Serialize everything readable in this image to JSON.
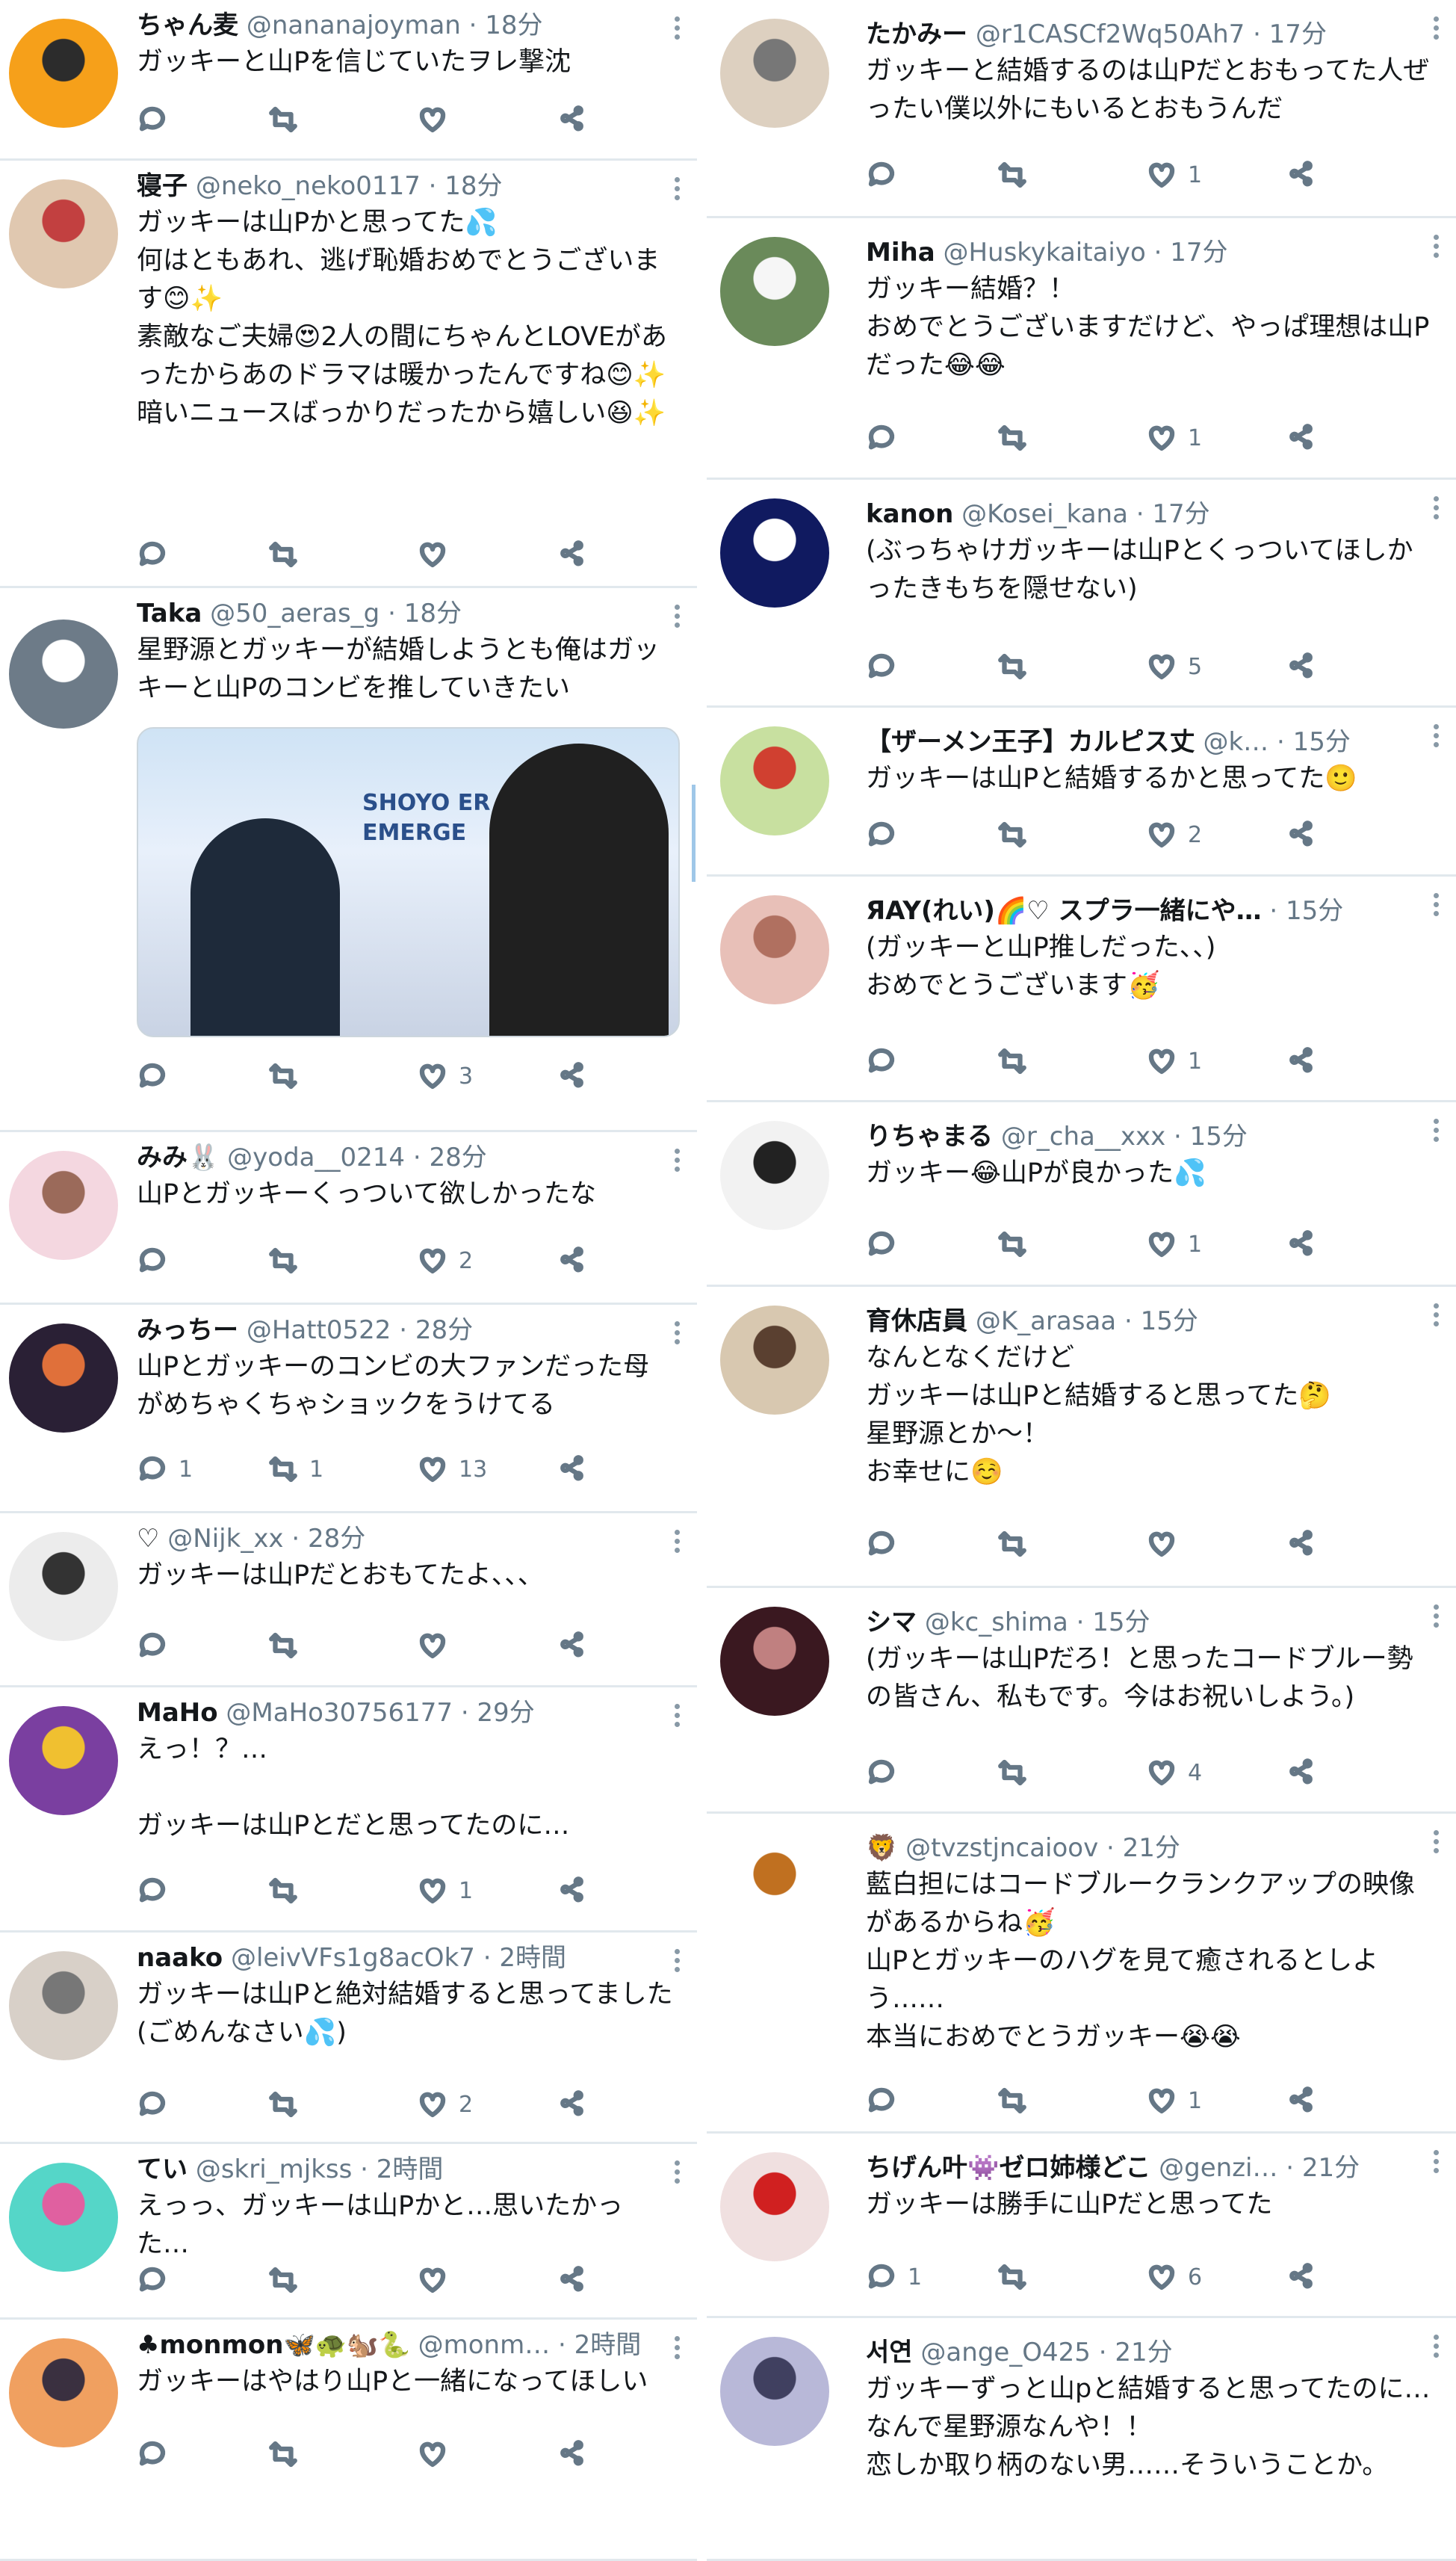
{
  "left": [
    {
      "name": "ちゃん麦",
      "handle": "@nananajoyman",
      "time": "· 18分",
      "text": "ガッキーと山Pを信じていたヲレ撃沈",
      "reply": "",
      "retweet": "",
      "like": ""
    },
    {
      "name": "寝子",
      "handle": "@neko_neko0117",
      "time": "· 18分",
      "text": "ガッキーは山Pかと思ってた💦\n何はともあれ、逃げ恥婚おめでとうございます😊✨\n素敵なご夫婦😍2人の間にちゃんとLOVEがあったからあのドラマは暖かったんですね😊✨\n暗いニュースばっかりだったから嬉しい😆✨",
      "reply": "",
      "retweet": "",
      "like": ""
    },
    {
      "name": "Taka",
      "handle": "@50_aeras_g",
      "time": "· 18分",
      "text": "星野源とガッキーが結婚しようとも俺はガッキーと山Pのコンビを推していきたい",
      "reply": "",
      "retweet": "",
      "like": "3",
      "media_caption": "SHOYO ER EMERGE"
    },
    {
      "name": "みみ🐰",
      "handle": "@yoda__0214",
      "time": "· 28分",
      "text": "山Pとガッキーくっついて欲しかったな",
      "reply": "",
      "retweet": "",
      "like": "2"
    },
    {
      "name": "みっちー",
      "handle": "@Hatt0522",
      "time": "· 28分",
      "text": "山Pとガッキーのコンビの大ファンだった母がめちゃくちゃショックをうけてる",
      "reply": "1",
      "retweet": "1",
      "like": "13"
    },
    {
      "name": "♡",
      "handle": "@Nijk_xx",
      "time": "· 28分",
      "text": "ガッキーは山Pだとおもてたよ、、、",
      "reply": "",
      "retweet": "",
      "like": ""
    },
    {
      "name": "MaHo",
      "handle": "@MaHo30756177",
      "time": "· 29分",
      "text": "えっ！？…\n\nガッキーは山Pとだと思ってたのに…",
      "reply": "",
      "retweet": "",
      "like": "1"
    },
    {
      "name": "naako",
      "handle": "@leivVFs1g8acOk7",
      "time": "· 2時間",
      "text": "ガッキーは山Pと絶対結婚すると思ってました(ごめんなさい💦)",
      "reply": "",
      "retweet": "",
      "like": "2"
    },
    {
      "name": "てい",
      "handle": "@skri_mjkss",
      "time": "· 2時間",
      "text": "えっっ、ガッキーは山Pかと…思いたかった…",
      "reply": "",
      "retweet": "",
      "like": ""
    },
    {
      "name": "♣monmon🦋🐢🐿️🐍",
      "handle": "@monm…",
      "time": "· 2時間",
      "text": "ガッキーはやはり山Pと一緒になってほしい",
      "reply": "",
      "retweet": "",
      "like": ""
    }
  ],
  "right": [
    {
      "name": "たかみー",
      "handle": "@r1CASCf2Wq50Ah7",
      "time": "· 17分",
      "text": "ガッキーと結婚するのは山Pだとおもってた人ぜったい僕以外にもいるとおもうんだ",
      "reply": "",
      "retweet": "",
      "like": "1"
    },
    {
      "name": "Miha",
      "handle": "@Huskykaitaiyo",
      "time": "· 17分",
      "text": "ガッキー結婚？！\nおめでとうございますだけど、やっぱ理想は山Pだった😂😂",
      "reply": "",
      "retweet": "",
      "like": "1"
    },
    {
      "name": "kanon",
      "handle": "@Kosei_kana",
      "time": "· 17分",
      "text": "(ぶっちゃけガッキーは山Pとくっついてほしかったきもちを隠せない)",
      "reply": "",
      "retweet": "",
      "like": "5"
    },
    {
      "name": "【ザーメン王子】カルピス丈",
      "handle": "@k…",
      "time": "· 15分",
      "text": "ガッキーは山Pと結婚するかと思ってた🙂",
      "reply": "",
      "retweet": "",
      "like": "2"
    },
    {
      "name": "ЯAY(れい)🌈♡ スプラ一緒にや…",
      "handle": "",
      "time": "· 15分",
      "text": "(ガッキーと山P推しだった、、)\nおめでとうございます🥳",
      "reply": "",
      "retweet": "",
      "like": "1"
    },
    {
      "name": "りちゃまる",
      "handle": "@r_cha__xxx",
      "time": "· 15分",
      "text": "ガッキー😂山Pが良かった💦",
      "reply": "",
      "retweet": "",
      "like": "1"
    },
    {
      "name": "育休店員",
      "handle": "@K_arasaa",
      "time": "· 15分",
      "text": "なんとなくだけど\nガッキーは山Pと結婚すると思ってた🤔\n星野源とか〜！\nお幸せに☺️",
      "reply": "",
      "retweet": "",
      "like": ""
    },
    {
      "name": "シマ",
      "handle": "@kc_shima",
      "time": "· 15分",
      "text": "(ガッキーは山Pだろ！と思ったコードブルー勢の皆さん、私もです。今はお祝いしよう。)",
      "reply": "",
      "retweet": "",
      "like": "4"
    },
    {
      "name": "🦁",
      "handle": "@tvzstjncaioov",
      "time": "· 21分",
      "text": "藍白担にはコードブルークランクアップの映像があるからね🥳\n山Pとガッキーのハグを見て癒されるとしよう……\n本当におめでとうガッキー😭😭",
      "reply": "",
      "retweet": "",
      "like": "1"
    },
    {
      "name": "ちげん叶👾ゼロ姉様どこ",
      "handle": "@genzi…",
      "time": "· 21分",
      "text": "ガッキーは勝手に山Pだと思ってた",
      "reply": "1",
      "retweet": "",
      "like": "6"
    },
    {
      "name": "서연",
      "handle": "@ange_O425",
      "time": "· 21分",
      "text": "ガッキーずっと山pと結婚すると思ってたのに…\nなんで星野源なんや！！\n恋しか取り柄のない男……そういうことか。",
      "reply": "",
      "retweet": "",
      "like": ""
    }
  ]
}
